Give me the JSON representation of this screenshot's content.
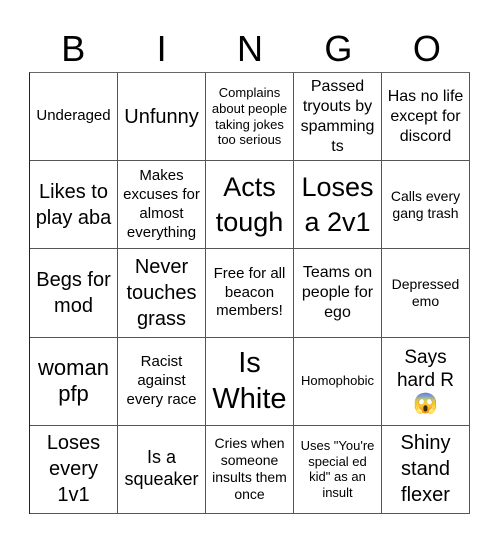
{
  "header": {
    "letters": [
      "B",
      "I",
      "N",
      "G",
      "O"
    ]
  },
  "cells": [
    [
      "Underaged",
      "Unfunny",
      "Complains about people taking jokes too serious",
      "Passed tryouts by spamming ts",
      "Has no life except for discord"
    ],
    [
      "Likes to play aba",
      "Makes excuses for almost everything",
      "Acts tough",
      "Loses a 2v1",
      "Calls every gang trash"
    ],
    [
      "Begs for mod",
      "Never touches grass",
      "Free for all beacon members!",
      "Teams on people for ego",
      "Depressed emo"
    ],
    [
      "woman pfp",
      "Racist against every race",
      "Is White",
      "Homophobic",
      "Says hard R"
    ],
    [
      "Loses every 1v1",
      "Is a squeaker",
      "Cries when someone insults them once",
      "Uses \"You're special ed kid\" as an insult",
      "Shiny stand flexer"
    ]
  ],
  "icons": {
    "screaming_face": "😱"
  }
}
